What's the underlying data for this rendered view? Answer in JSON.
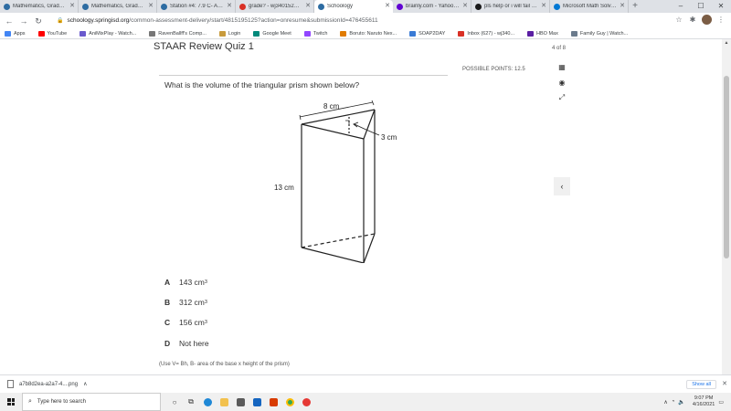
{
  "tabs": [
    {
      "title": "Mathematics, Grade 7: Sect",
      "color": "#2d6ca2",
      "active": false
    },
    {
      "title": "Mathematics, Grade 7: Sect",
      "color": "#2d6ca2",
      "active": false
    },
    {
      "title": "Station #4: 7.9 C- Area of ",
      "color": "#2d6ca2",
      "active": false
    },
    {
      "title": "grade? - wj34015230@stu",
      "color": "#d93025",
      "active": false
    },
    {
      "title": "Schoology",
      "color": "#2d6ca2",
      "active": true
    },
    {
      "title": "brainly.com - Yahoo Search",
      "color": "#6001d2",
      "active": false
    },
    {
      "title": "pls help or i will fail - Brain",
      "color": "#1a1a1a",
      "active": false
    },
    {
      "title": "Microsoft Math Solver - Ste",
      "color": "#0078d4",
      "active": false
    }
  ],
  "new_tab": "+",
  "window_controls": {
    "minimize": "–",
    "maximize": "☐",
    "close": "✕"
  },
  "address": {
    "host": "schoology.springisd.org",
    "path": "/common-assessment-delivery/start/4815195125?action=onresume&submissionId=476455611"
  },
  "bookmarks": [
    {
      "label": "Apps",
      "color": "#4285f4"
    },
    {
      "label": "YouTube",
      "color": "#ff0000"
    },
    {
      "label": "AniMixPlay - Watch...",
      "color": "#6a5acd"
    },
    {
      "label": "RavenBallff's Comp...",
      "color": "#777777"
    },
    {
      "label": "Login",
      "color": "#c89b3c"
    },
    {
      "label": "Google Meet",
      "color": "#00897b"
    },
    {
      "label": "Twitch",
      "color": "#9146ff"
    },
    {
      "label": "Boruto: Naruto Nex...",
      "color": "#e07b00"
    },
    {
      "label": "SOAP2DAY",
      "color": "#3a7bd5"
    },
    {
      "label": "Inbox (627) - wj340...",
      "color": "#d93025"
    },
    {
      "label": "HBO Max",
      "color": "#5b1fa3"
    },
    {
      "label": "Family Guy | Watch...",
      "color": "#6b7b8c"
    }
  ],
  "quiz": {
    "title": "STAAR Review Quiz 1",
    "progress": "4 of 8",
    "points": "POSSIBLE POINTS: 12.5",
    "question": "What is the volume of the triangular prism shown below?",
    "hint": "(Use V= Bh, B- area of the base x height of the prism)"
  },
  "figure": {
    "base_label": "8 cm",
    "height_label": "3 cm",
    "length_label": "13 cm"
  },
  "choices": [
    {
      "letter": "A",
      "value": "143 cm",
      "unit_exp": "3"
    },
    {
      "letter": "B",
      "value": "312 cm",
      "unit_exp": "3"
    },
    {
      "letter": "C",
      "value": "156 cm",
      "unit_exp": "3"
    },
    {
      "letter": "D",
      "value": "Not here",
      "unit_exp": ""
    }
  ],
  "download": {
    "filename": "a7b8d2ea-a2a7-4....png",
    "show_all": "Show all"
  },
  "taskbar": {
    "search_placeholder": "Type here to search",
    "time": "9:07 PM",
    "date": "4/16/2021"
  }
}
